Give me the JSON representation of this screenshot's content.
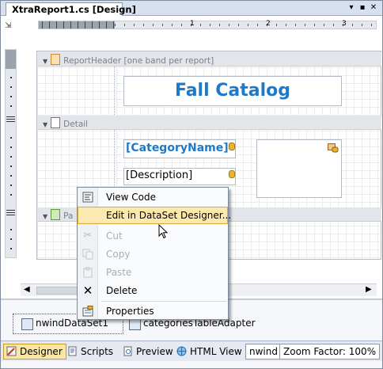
{
  "window": {
    "tab_title": "XtraReport1.cs [Design]",
    "pin_glyph": "▾",
    "auto_hide_glyph": "▪",
    "close_glyph": "✕"
  },
  "ruler": {
    "numbers": [
      "1",
      "2",
      "3"
    ]
  },
  "report": {
    "bands": {
      "report_header": "ReportHeader [one band per report]",
      "detail": "Detail",
      "page_footer": "Pa"
    },
    "title_text": "Fall Catalog",
    "category_name_field": "[CategoryName]",
    "description_field": "[Description]"
  },
  "context_menu": {
    "items": {
      "view_code": "View Code",
      "edit_dataset": "Edit in DataSet Designer...",
      "cut": "Cut",
      "copy": "Copy",
      "paste": "Paste",
      "delete": "Delete",
      "properties": "Properties"
    }
  },
  "component_tray": {
    "items": [
      "nwindDataSet1",
      "categoriesTableAdapter"
    ]
  },
  "bottom_bar": {
    "designer": "Designer",
    "scripts": "Scripts",
    "preview": "Preview",
    "html_view": "HTML View",
    "data_source": "nwind",
    "zoom": "Zoom Factor: 100%"
  },
  "colors": {
    "accent_blue": "#1e7ac8",
    "menu_highlight": "#fbe9b0",
    "selected_tab": "#fbe7a5"
  }
}
